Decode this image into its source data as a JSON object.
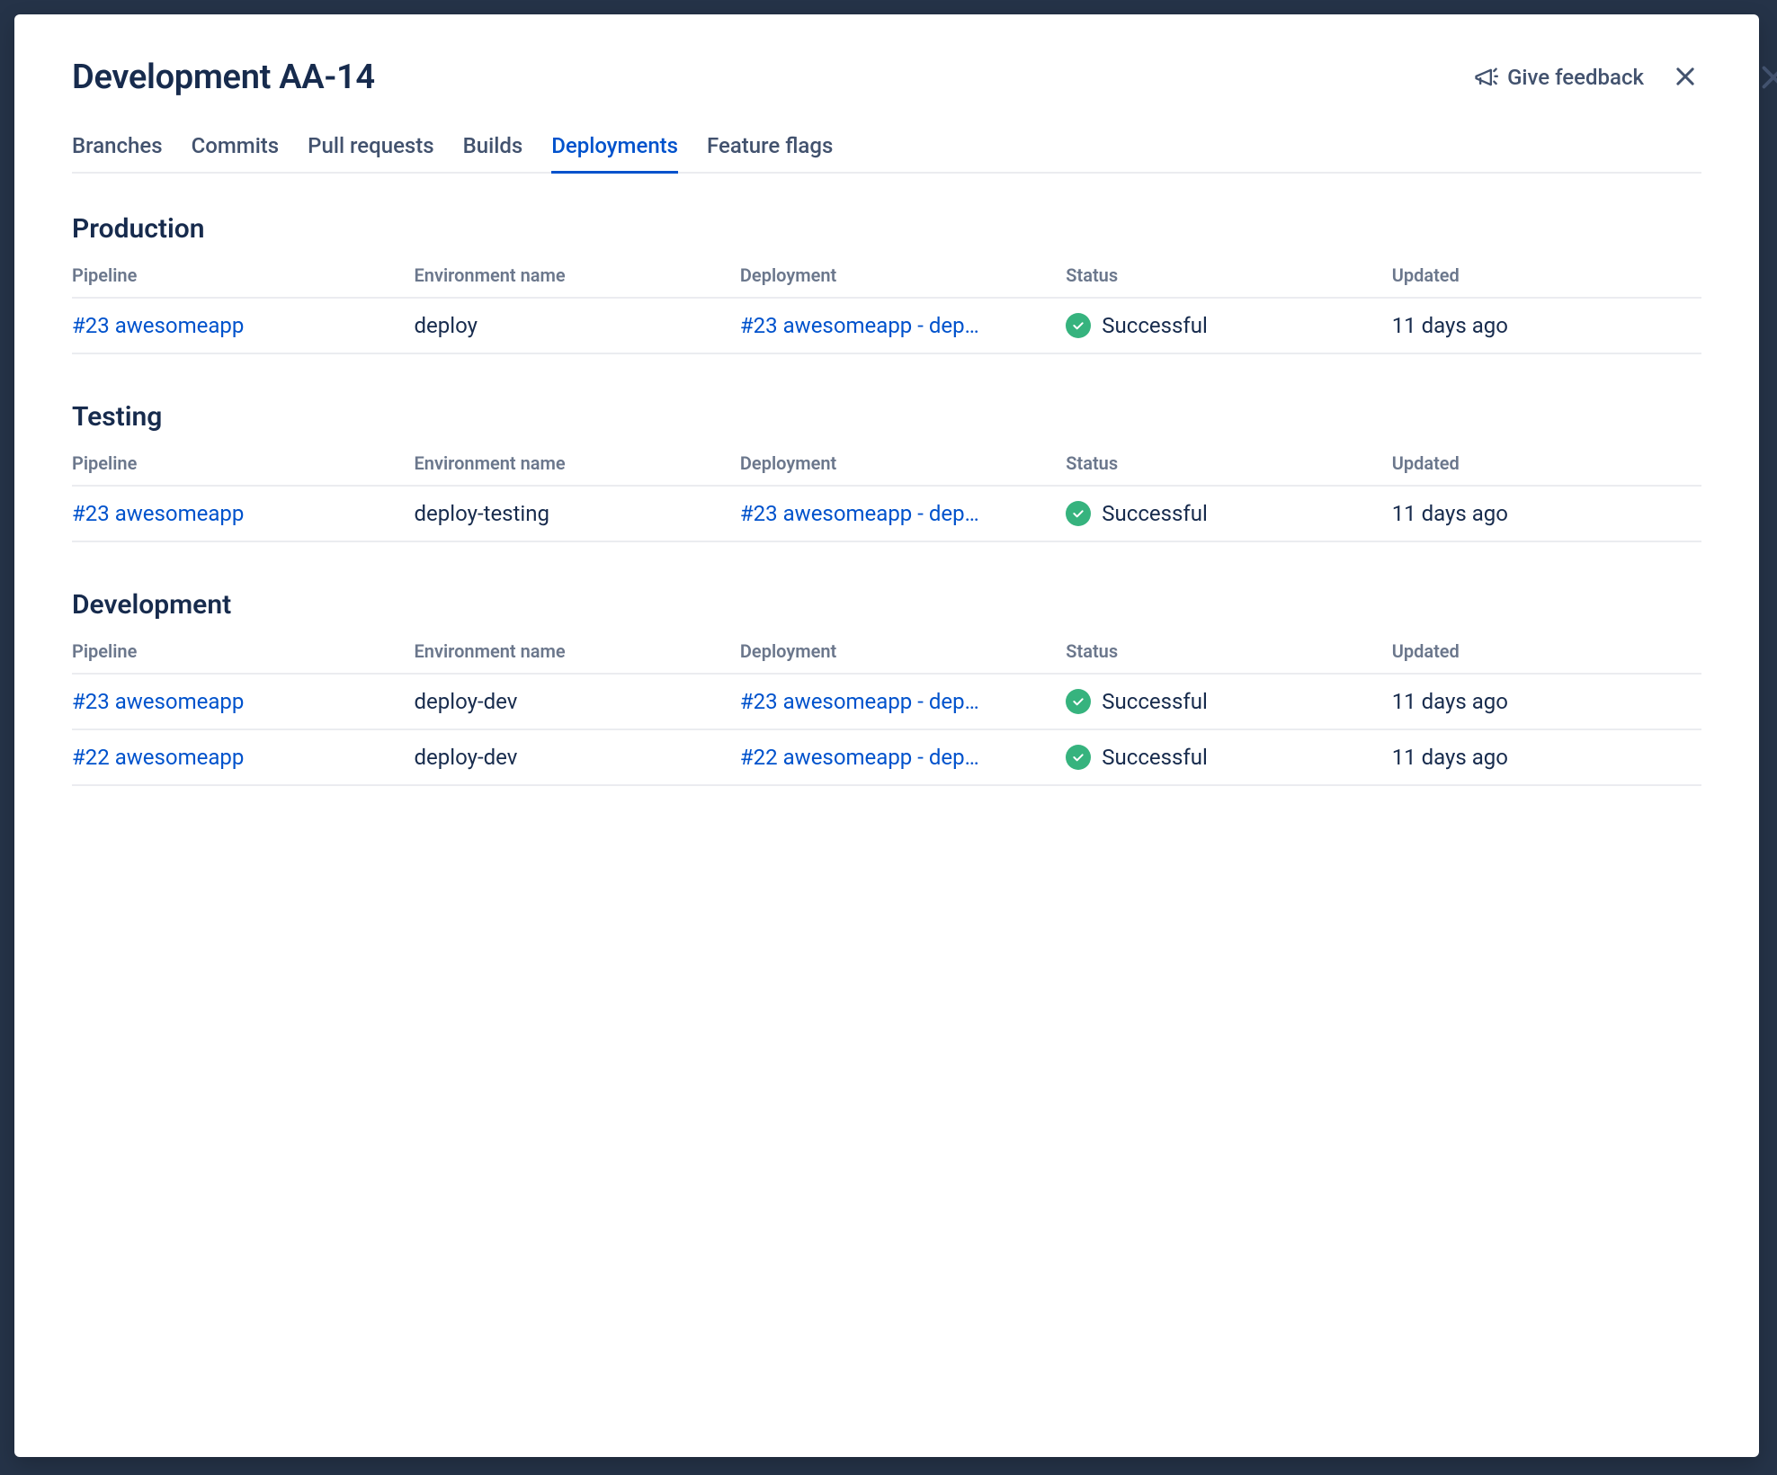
{
  "modal": {
    "title": "Development AA-14",
    "feedback_label": "Give feedback"
  },
  "tabs": [
    {
      "label": "Branches",
      "active": false
    },
    {
      "label": "Commits",
      "active": false
    },
    {
      "label": "Pull requests",
      "active": false
    },
    {
      "label": "Builds",
      "active": false
    },
    {
      "label": "Deployments",
      "active": true
    },
    {
      "label": "Feature flags",
      "active": false
    }
  ],
  "columns": {
    "pipeline": "Pipeline",
    "environment": "Environment name",
    "deployment": "Deployment",
    "status": "Status",
    "updated": "Updated"
  },
  "sections": [
    {
      "title": "Production",
      "rows": [
        {
          "pipeline": "#23 awesomeapp",
          "environment": "deploy",
          "deployment": "#23 awesomeapp - dep…",
          "status": "Successful",
          "updated": "11 days ago"
        }
      ]
    },
    {
      "title": "Testing",
      "rows": [
        {
          "pipeline": "#23 awesomeapp",
          "environment": "deploy-testing",
          "deployment": "#23 awesomeapp - dep…",
          "status": "Successful",
          "updated": "11 days ago"
        }
      ]
    },
    {
      "title": "Development",
      "rows": [
        {
          "pipeline": "#23 awesomeapp",
          "environment": "deploy-dev",
          "deployment": "#23 awesomeapp - dep…",
          "status": "Successful",
          "updated": "11 days ago"
        },
        {
          "pipeline": "#22 awesomeapp",
          "environment": "deploy-dev",
          "deployment": "#22 awesomeapp - dep…",
          "status": "Successful",
          "updated": "11 days ago"
        }
      ]
    }
  ]
}
